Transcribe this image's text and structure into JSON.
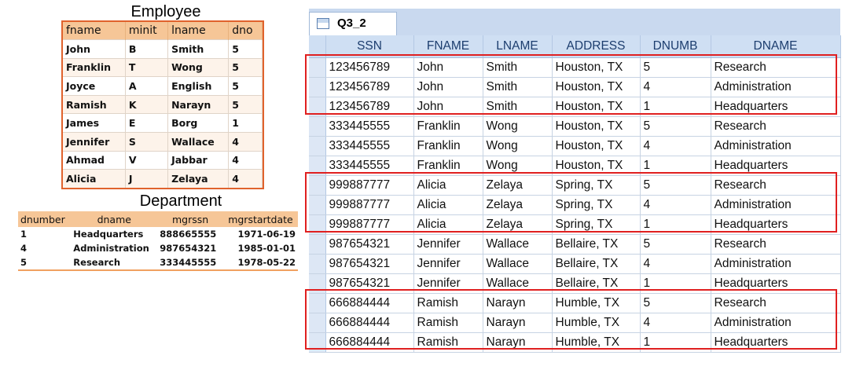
{
  "employee": {
    "title": "Employee",
    "columns": [
      "fname",
      "minit",
      "lname",
      "dno"
    ],
    "rows": [
      [
        "John",
        "B",
        "Smith",
        "5"
      ],
      [
        "Franklin",
        "T",
        "Wong",
        "5"
      ],
      [
        "Joyce",
        "A",
        "English",
        "5"
      ],
      [
        "Ramish",
        "K",
        "Narayn",
        "5"
      ],
      [
        "James",
        "E",
        "Borg",
        "1"
      ],
      [
        "Jennifer",
        "S",
        "Wallace",
        "4"
      ],
      [
        "Ahmad",
        "V",
        "Jabbar",
        "4"
      ],
      [
        "Alicia",
        "J",
        "Zelaya",
        "4"
      ]
    ]
  },
  "department": {
    "title": "Department",
    "columns": [
      "dnumber",
      "dname",
      "mgrssn",
      "mgrstartdate"
    ],
    "rows": [
      [
        "1",
        "Headquarters",
        "888665555",
        "1971-06-19"
      ],
      [
        "4",
        "Administration",
        "987654321",
        "1985-01-01"
      ],
      [
        "5",
        "Research",
        "333445555",
        "1978-05-22"
      ]
    ]
  },
  "query": {
    "tab_label": "Q3_2",
    "columns": [
      "SSN",
      "FNAME",
      "LNAME",
      "ADDRESS",
      "DNUMB",
      "DNAME"
    ],
    "rows": [
      [
        "123456789",
        "John",
        "Smith",
        "Houston, TX",
        "5",
        "Research"
      ],
      [
        "123456789",
        "John",
        "Smith",
        "Houston, TX",
        "4",
        "Administration"
      ],
      [
        "123456789",
        "John",
        "Smith",
        "Houston, TX",
        "1",
        "Headquarters"
      ],
      [
        "333445555",
        "Franklin",
        "Wong",
        "Houston, TX",
        "5",
        "Research"
      ],
      [
        "333445555",
        "Franklin",
        "Wong",
        "Houston, TX",
        "4",
        "Administration"
      ],
      [
        "333445555",
        "Franklin",
        "Wong",
        "Houston, TX",
        "1",
        "Headquarters"
      ],
      [
        "999887777",
        "Alicia",
        "Zelaya",
        "Spring, TX",
        "5",
        "Research"
      ],
      [
        "999887777",
        "Alicia",
        "Zelaya",
        "Spring, TX",
        "4",
        "Administration"
      ],
      [
        "999887777",
        "Alicia",
        "Zelaya",
        "Spring, TX",
        "1",
        "Headquarters"
      ],
      [
        "987654321",
        "Jennifer",
        "Wallace",
        "Bellaire, TX",
        "5",
        "Research"
      ],
      [
        "987654321",
        "Jennifer",
        "Wallace",
        "Bellaire, TX",
        "4",
        "Administration"
      ],
      [
        "987654321",
        "Jennifer",
        "Wallace",
        "Bellaire, TX",
        "1",
        "Headquarters"
      ],
      [
        "666884444",
        "Ramish",
        "Narayn",
        "Humble, TX",
        "5",
        "Research"
      ],
      [
        "666884444",
        "Ramish",
        "Narayn",
        "Humble, TX",
        "4",
        "Administration"
      ],
      [
        "666884444",
        "Ramish",
        "Narayn",
        "Humble, TX",
        "1",
        "Headquarters"
      ]
    ],
    "highlight_color": "#e02020",
    "header_color": "#cfdff3"
  }
}
